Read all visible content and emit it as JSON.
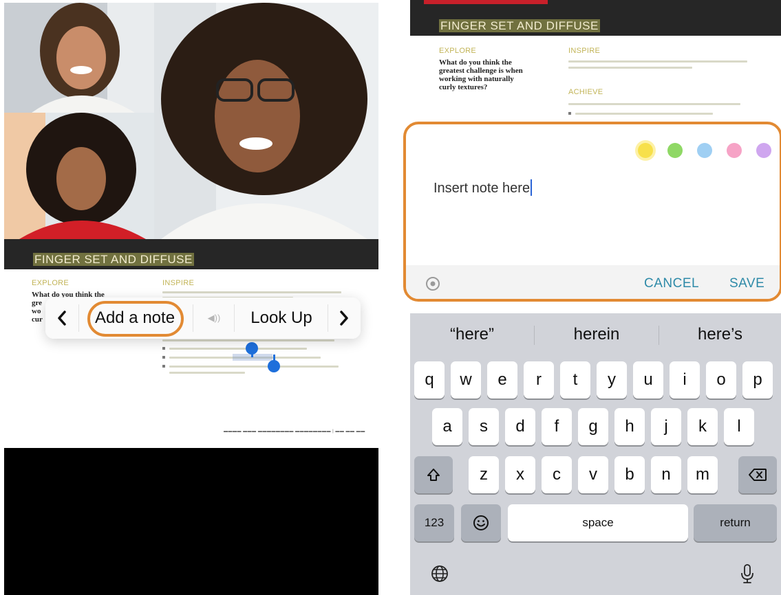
{
  "document": {
    "banner_title": "FINGER SET AND DIFFUSE",
    "explore_label": "EXPLORE",
    "inspire_label": "INSPIRE",
    "achieve_label": "ACHIEVE",
    "question_lines": [
      "What do you think the",
      "greatest challenge is when",
      "working with naturally",
      "curly textures?"
    ],
    "question_partial_lines": [
      "What do you think the",
      "gre",
      "wo",
      "cur"
    ]
  },
  "popup_menu": {
    "prev_icon": "chevron-left-icon",
    "add_note_label": "Add a note",
    "speak_icon": "speaker-icon",
    "speak_label": "◀))",
    "look_up_label": "Look Up",
    "next_icon": "chevron-right-icon"
  },
  "note_editor": {
    "colors": [
      {
        "name": "yellow",
        "hex": "#f7e04b",
        "selected": true
      },
      {
        "name": "green",
        "hex": "#8fd865"
      },
      {
        "name": "blue",
        "hex": "#9fcff3"
      },
      {
        "name": "pink",
        "hex": "#f6a3c6"
      },
      {
        "name": "purple",
        "hex": "#cfa6ef"
      }
    ],
    "text": "Insert note here",
    "location_icon": "target-icon",
    "cancel_label": "CANCEL",
    "save_label": "SAVE"
  },
  "keyboard": {
    "suggestions": [
      "“here”",
      "herein",
      "here’s"
    ],
    "row1": [
      "q",
      "w",
      "e",
      "r",
      "t",
      "y",
      "u",
      "i",
      "o",
      "p"
    ],
    "row2": [
      "a",
      "s",
      "d",
      "f",
      "g",
      "h",
      "j",
      "k",
      "l"
    ],
    "row3": [
      "z",
      "x",
      "c",
      "v",
      "b",
      "n",
      "m"
    ],
    "shift_icon": "shift-icon",
    "delete_icon": "delete-icon",
    "numbers_label": "123",
    "emoji_icon": "emoji-icon",
    "space_label": "space",
    "return_label": "return",
    "globe_icon": "globe-icon",
    "mic_icon": "microphone-icon"
  },
  "colors": {
    "accent_orange": "#e28a33",
    "button_teal": "#2e8aa8",
    "selection_blue": "#1e6fdb"
  }
}
